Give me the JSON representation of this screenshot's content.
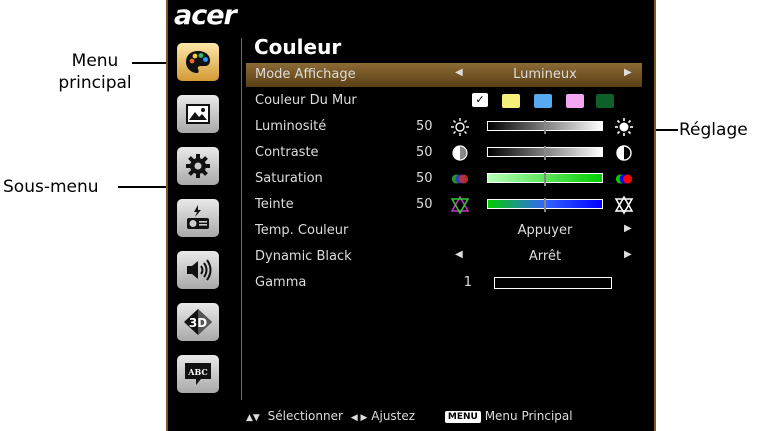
{
  "callouts": {
    "menu_principal_line1": "Menu",
    "menu_principal_line2": "principal",
    "sous_menu": "Sous-menu",
    "reglage": "Réglage"
  },
  "brand": "acer",
  "sidebar": [
    {
      "icon": "palette-icon",
      "active": true
    },
    {
      "icon": "image-icon",
      "active": false
    },
    {
      "icon": "gear-icon",
      "active": false
    },
    {
      "icon": "projector-icon",
      "active": false
    },
    {
      "icon": "speaker-icon",
      "active": false
    },
    {
      "icon": "3d-icon",
      "active": false
    },
    {
      "icon": "language-icon",
      "active": false,
      "text": "ABC"
    }
  ],
  "menu": {
    "title": "Couleur",
    "rows": {
      "mode": {
        "label": "Mode Affichage",
        "value": "Lumineux"
      },
      "wall": {
        "label": "Couleur Du Mur",
        "colors": [
          "#f6f07a",
          "#57a9f2",
          "#f6a6f0",
          "#0f5f2a"
        ]
      },
      "brightness": {
        "label": "Luminosité",
        "value": "50",
        "level": 0.5
      },
      "contrast": {
        "label": "Contraste",
        "value": "50",
        "level": 0.5
      },
      "saturation": {
        "label": "Saturation",
        "value": "50",
        "level": 0.5
      },
      "tint": {
        "label": "Teinte",
        "value": "50",
        "level": 0.5
      },
      "temp": {
        "label": "Temp. Couleur",
        "value": "Appuyer"
      },
      "dynamic_black": {
        "label": "Dynamic Black",
        "value": "Arrêt"
      },
      "gamma": {
        "label": "Gamma",
        "value": "1"
      }
    }
  },
  "footer": {
    "select": "Sélectionner",
    "adjust": "Ajustez",
    "menu_key": "MENU",
    "menu_main": "Menu Principal"
  },
  "colors": {
    "selected_row": "#8b6a34",
    "frame": "#7a5a1e"
  }
}
